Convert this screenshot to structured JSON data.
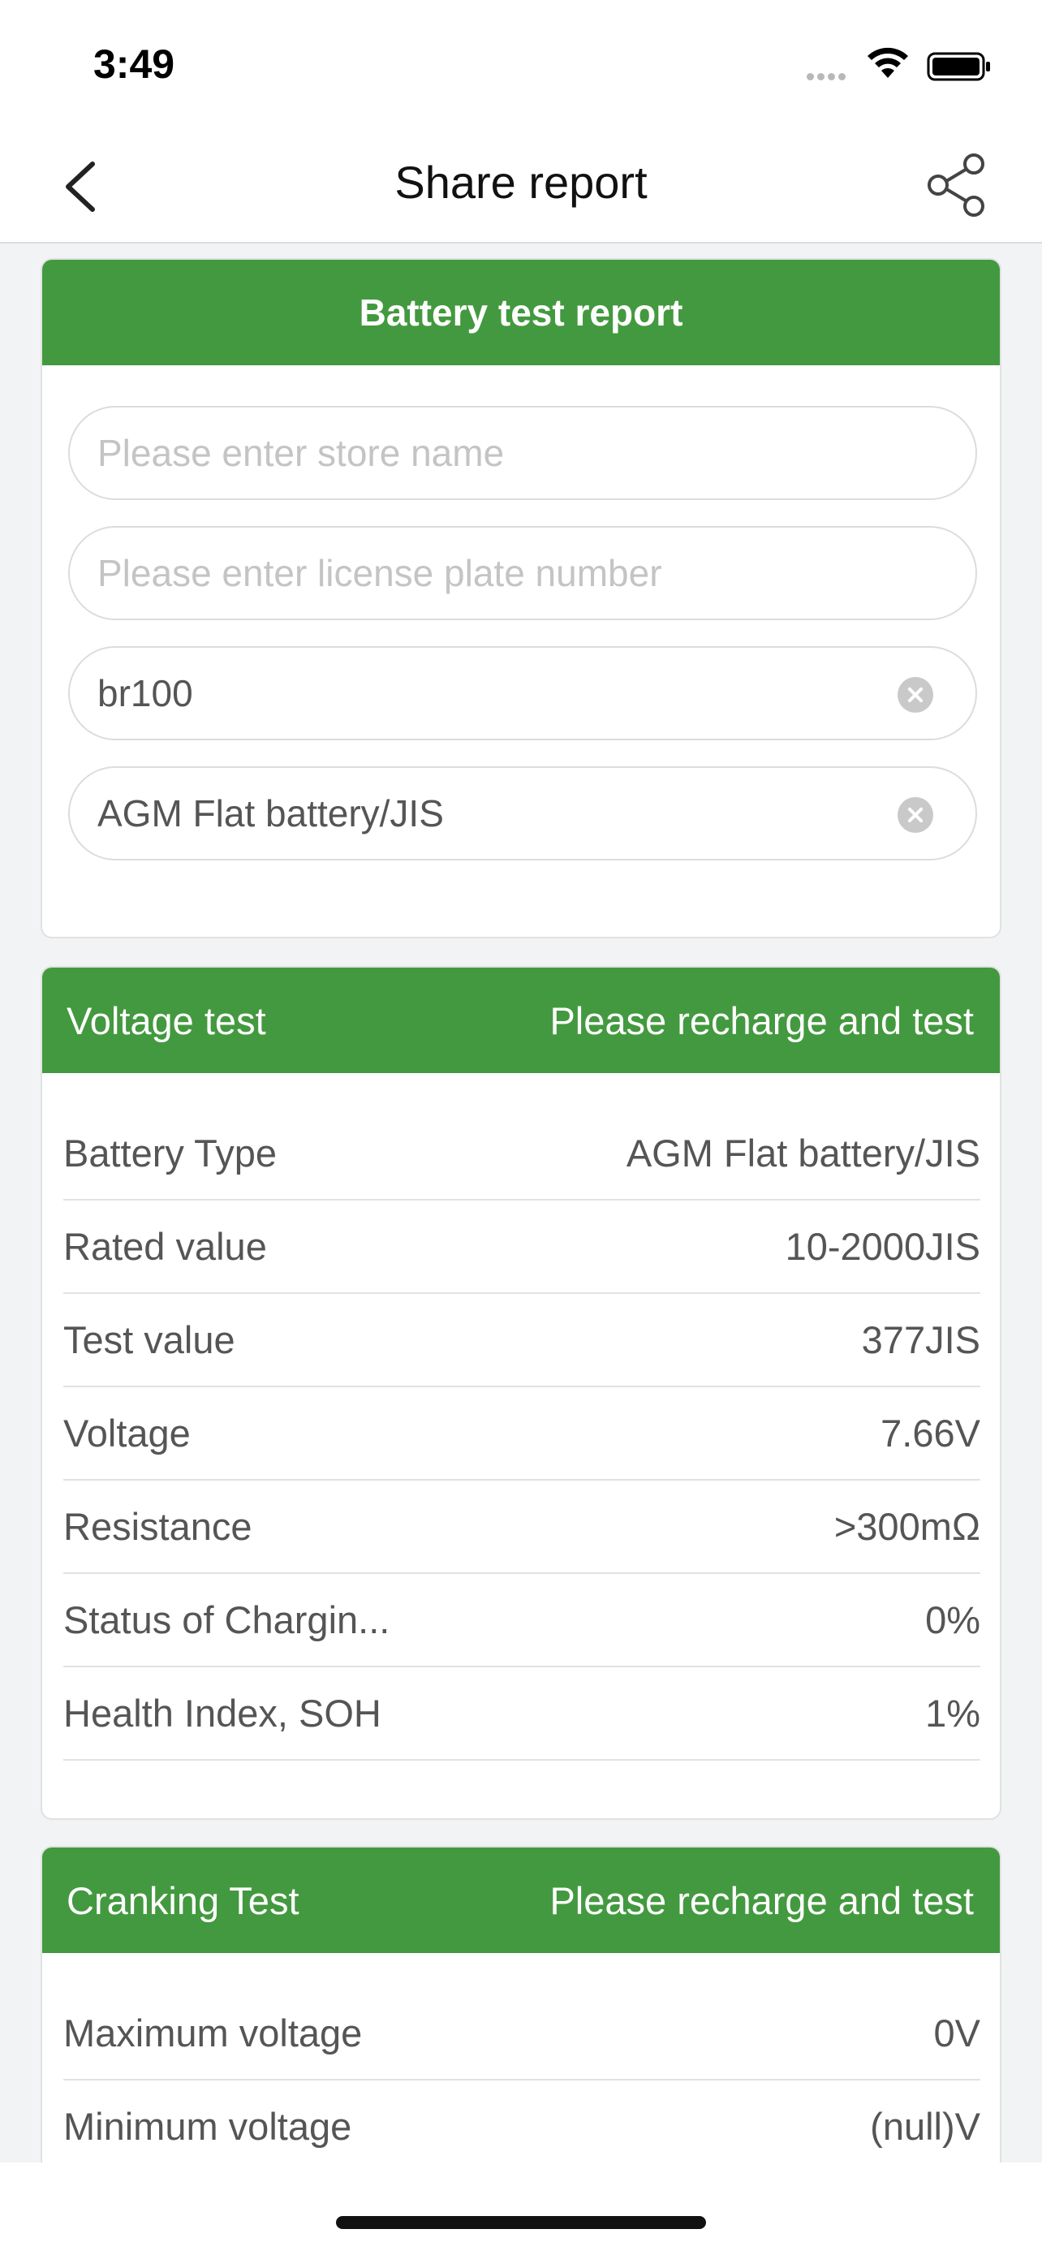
{
  "status_bar": {
    "time": "3:49"
  },
  "nav": {
    "title": "Share report",
    "back_icon": "chevron-left-icon",
    "share_icon": "share-icon"
  },
  "report_card": {
    "title": "Battery test report",
    "store_placeholder": "Please enter store name",
    "plate_placeholder": "Please enter license plate number",
    "device_value": "br100",
    "battery_value": "AGM Flat battery/JIS"
  },
  "voltage_test": {
    "title": "Voltage test",
    "status": "Please recharge and test",
    "rows": [
      {
        "label": "Battery Type",
        "value": "AGM Flat battery/JIS"
      },
      {
        "label": "Rated value",
        "value": "10-2000JIS"
      },
      {
        "label": "Test value",
        "value": "377JIS"
      },
      {
        "label": "Voltage",
        "value": "7.66V"
      },
      {
        "label": "Resistance",
        "value": ">300mΩ"
      },
      {
        "label": "Status of Chargin...",
        "value": "0%"
      },
      {
        "label": "Health Index, SOH",
        "value": "1%"
      }
    ]
  },
  "cranking_test": {
    "title": "Cranking Test",
    "status": "Please recharge and test",
    "rows": [
      {
        "label": "Maximum voltage",
        "value": "0V"
      },
      {
        "label": "Minimum voltage",
        "value": "(null)V"
      }
    ]
  },
  "colors": {
    "accent": "#43993f"
  }
}
